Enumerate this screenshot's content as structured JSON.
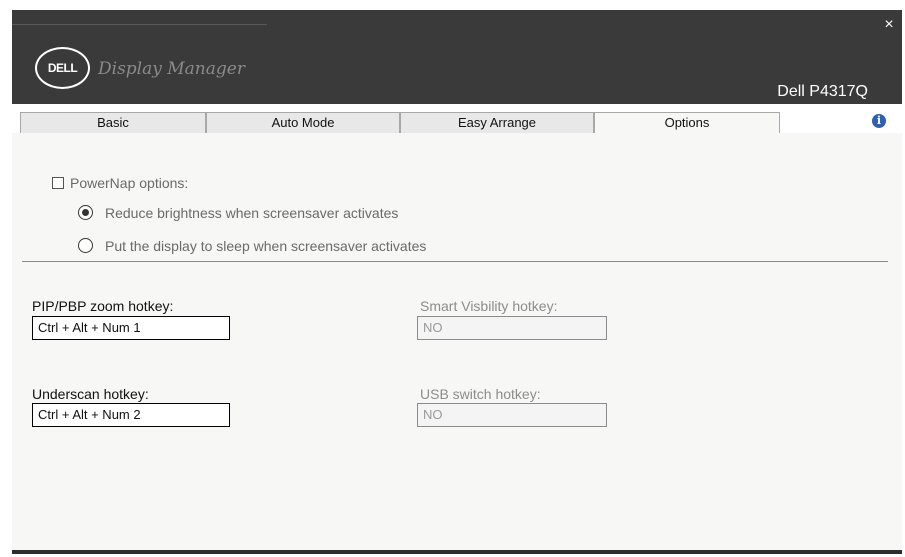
{
  "window": {
    "app_title": "Display Manager",
    "logo_text": "DELL",
    "monitor_name": "Dell P4317Q",
    "close_symbol": "×"
  },
  "tabs": [
    {
      "label": "Basic",
      "active": false
    },
    {
      "label": "Auto Mode",
      "active": false
    },
    {
      "label": "Easy Arrange",
      "active": false
    },
    {
      "label": "Options",
      "active": true
    }
  ],
  "info_icon": "info-icon",
  "powernap": {
    "label": "PowerNap options:",
    "checked": false,
    "options": [
      {
        "label": "Reduce brightness when screensaver activates",
        "selected": true
      },
      {
        "label": "Put the display to sleep when screensaver activates",
        "selected": false
      }
    ]
  },
  "hotkeys": {
    "pip_label": "PIP/PBP zoom hotkey:",
    "pip_value": "Ctrl + Alt + Num 1",
    "smart_label": "Smart Visbility hotkey:",
    "smart_value": "NO",
    "underscan_label": "Underscan hotkey:",
    "underscan_value": "Ctrl + Alt + Num 2",
    "usb_label": "USB switch hotkey:",
    "usb_value": "NO"
  },
  "colors": {
    "titlebar": "#3a3a3a",
    "content_bg": "#f7f7f5",
    "info_blue": "#2f5fb0"
  }
}
